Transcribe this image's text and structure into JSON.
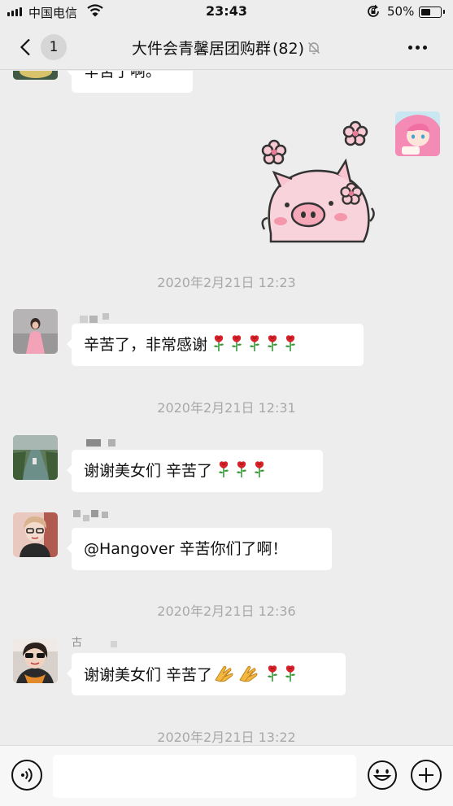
{
  "status_bar": {
    "carrier": "中国电信",
    "time": "23:43",
    "battery_percent_label": "50%",
    "battery_level": 0.5,
    "signal_bars": 4,
    "icons": [
      "signal-icon",
      "wifi-icon",
      "orientation-lock-icon",
      "battery-icon"
    ]
  },
  "nav": {
    "back_badge": "1",
    "title": "大件会青馨居团购群",
    "member_count": "(82)",
    "icons": [
      "back-chevron-icon",
      "mute-bell-icon",
      "more-dots-icon"
    ]
  },
  "messages": {
    "partial_top_text": "辛苦了啊。",
    "sticker": "pink-pig-sticker",
    "timestamps": [
      "2020年2月21日 12:23",
      "2020年2月21日 12:31",
      "2020年2月21日 12:36",
      "2020年2月21日 13:22"
    ],
    "items": [
      {
        "text": "辛苦了，非常感谢",
        "emoji": "rose-icon x5"
      },
      {
        "text": "谢谢美女们 辛苦了",
        "emoji": "rose-icon x3"
      },
      {
        "text": "@Hangover 辛苦你们了啊！",
        "emoji": ""
      },
      {
        "text": "谢谢美女们 辛苦了",
        "emoji": "clap-icon x2, rose-icon x2"
      }
    ],
    "partial_sender_name": "古"
  },
  "input_bar": {
    "input_value": "",
    "icons": [
      "voice-icon",
      "emoji-icon",
      "plus-icon"
    ]
  },
  "colors": {
    "background": "#ededed",
    "bubble": "#ffffff",
    "timestamp": "#a8a8a8",
    "rose": "#d8232a",
    "rose_leaf": "#3a9a3a"
  }
}
